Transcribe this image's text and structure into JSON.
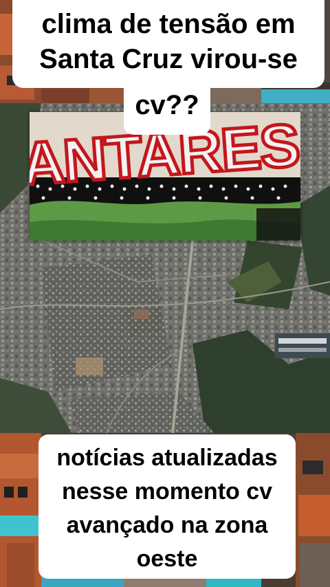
{
  "caption_top": {
    "lines": [
      "clima de tensão em",
      "Santa Cruz virou-se",
      "cv??"
    ]
  },
  "graffiti": {
    "text": "ANTARES"
  },
  "caption_bottom": {
    "lines": [
      "notícias atualizadas",
      "nesse momento cv",
      "avançado na zona",
      "oeste"
    ]
  },
  "colors": {
    "caption_background": "#ffffff",
    "caption_text": "#000000",
    "graffiti_red": "#c4161c",
    "graffiti_fill": "#f2f2f2"
  }
}
